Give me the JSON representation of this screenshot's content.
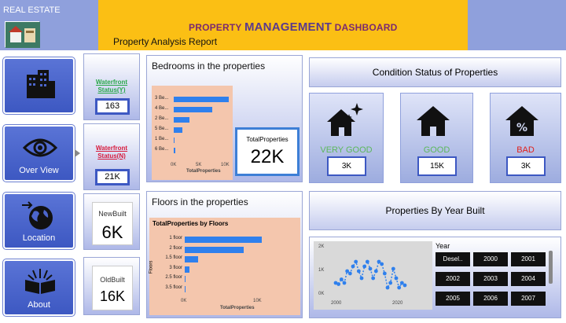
{
  "header": {
    "left_label": "REAL ESTATE",
    "title_part1": "PROPERTY",
    "title_part2": "MANAGEMENT",
    "title_part3": "DASHBOARD",
    "subtitle": "Property Analysis Report"
  },
  "nav": [
    {
      "label": ""
    },
    {
      "label": "Over View"
    },
    {
      "label": "Location"
    },
    {
      "label": "About"
    }
  ],
  "waterfront_y": {
    "label": "Waterfront Status(Y)",
    "value": "163"
  },
  "waterfront_n": {
    "label": "Waterfront Status(N)",
    "value": "21K"
  },
  "newbuilt": {
    "label": "NewBuilt",
    "value": "6K"
  },
  "oldbuilt": {
    "label": "OldBuilt",
    "value": "16K"
  },
  "bedrooms": {
    "title": "Bedrooms in the properties",
    "categories": [
      "3 Be...",
      "4 Be...",
      "2 Be...",
      "5 Be...",
      "1 Be...",
      "6 Be..."
    ],
    "values": [
      10000,
      7000,
      2800,
      1600,
      200,
      270
    ],
    "ticks": [
      "0K",
      "5K",
      "10K"
    ],
    "xlabel": "TotalProperties",
    "total_label": "TotalProperties",
    "total_value": "22K"
  },
  "floors": {
    "title": "Floors in the properties",
    "chart_title": "TotalProperties by Floors",
    "categories": [
      "1 floor",
      "2 floor",
      "1.5 floor",
      "3 floor",
      "2.5 floor",
      "3.5 floor"
    ],
    "values": [
      10700,
      8200,
      1900,
      600,
      160,
      8
    ],
    "ticks": [
      "0K",
      "10K"
    ],
    "xlabel": "TotalProperties",
    "ylabel": "Floors"
  },
  "condition": {
    "title": "Condition Status of Properties",
    "items": [
      {
        "label": "VERY GOOD",
        "value": "3K",
        "color": "#5cb85c",
        "icon": "house-sparkle-icon"
      },
      {
        "label": "GOOD",
        "value": "15K",
        "color": "#5cb85c",
        "icon": "house-icon"
      },
      {
        "label": "BAD",
        "value": "3K",
        "color": "#e0201b",
        "icon": "house-percent-icon"
      }
    ]
  },
  "year_built": {
    "title": "Properties By Year Built",
    "slicer_title": "Year",
    "years": [
      "Desel..",
      "2000",
      "2001",
      "2002",
      "2003",
      "2004",
      "2005",
      "2006",
      "2007"
    ],
    "axis_y": [
      "2K",
      "1K",
      "0K"
    ],
    "axis_x": [
      "2000",
      "2020"
    ]
  },
  "chart_data": [
    {
      "type": "bar",
      "title": "Bedrooms in the properties",
      "categories": [
        "3 Be...",
        "4 Be...",
        "2 Be...",
        "5 Be...",
        "1 Be...",
        "6 Be..."
      ],
      "values": [
        10000,
        7000,
        2800,
        1600,
        200,
        270
      ],
      "xlabel": "TotalProperties",
      "xlim": [
        0,
        10000
      ]
    },
    {
      "type": "bar",
      "title": "TotalProperties by Floors",
      "categories": [
        "1 floor",
        "2 floor",
        "1.5 floor",
        "3 floor",
        "2.5 floor",
        "3.5 floor"
      ],
      "values": [
        10700,
        8200,
        1900,
        600,
        160,
        8
      ],
      "xlabel": "TotalProperties",
      "ylabel": "Floors",
      "xlim": [
        0,
        10000
      ]
    },
    {
      "type": "line",
      "x": [
        1990,
        1991,
        1992,
        1993,
        1994,
        1995,
        1996,
        1997,
        1998,
        1999,
        2000,
        2001,
        2002,
        2003,
        2004,
        2005,
        2006,
        2007,
        2008,
        2009,
        2010,
        2011,
        2012,
        2013,
        2014
      ],
      "y": [
        500,
        450,
        650,
        500,
        1000,
        900,
        1200,
        1400,
        1000,
        700,
        1200,
        1400,
        1100,
        700,
        1000,
        1400,
        1300,
        900,
        300,
        500,
        1100,
        700,
        300,
        500,
        400
      ],
      "ylim": [
        0,
        2000
      ],
      "xlim": [
        1990,
        2020
      ]
    }
  ]
}
